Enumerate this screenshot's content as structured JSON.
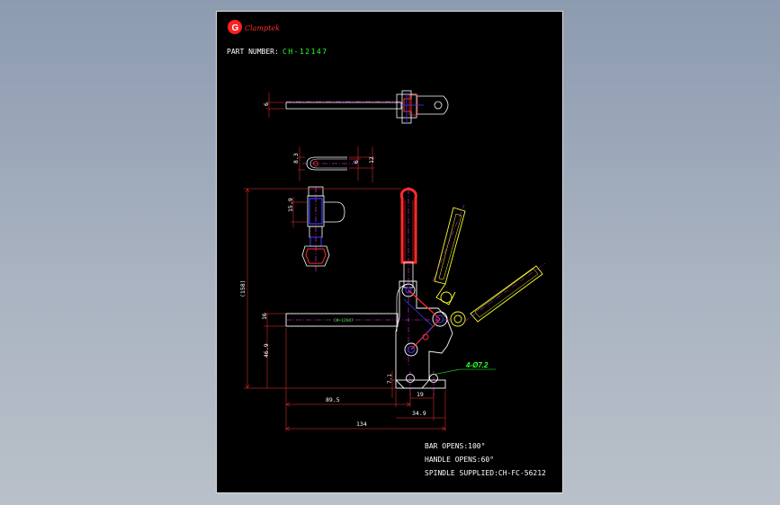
{
  "logo": {
    "letter": "G",
    "brand": "Clamptek"
  },
  "part_number": {
    "label": "PART NUMBER:",
    "value": "CH-12147"
  },
  "dimensions": {
    "top_view_thickness": "6",
    "bolt_left": "8.3",
    "bolt_inner": "6",
    "bolt_outer": "12",
    "spindle_len": "15.9",
    "overall_height": "(158)",
    "bar_width": "16",
    "bar_height": "46.9",
    "base_thk": "7.1",
    "hole_spacing": "19",
    "reach": "89.5",
    "base_len": "34.9",
    "overall_len": "134",
    "holes": "4-Ø7.2"
  },
  "bar_label": "CH-12147",
  "specs": [
    "BAR OPENS:100°",
    "HANDLE OPENS:60°",
    "SPINDLE SUPPLIED:CH-FC-56212"
  ],
  "colors": {
    "background": "#000000",
    "dimension": "#ff3030",
    "text": "#ffffff",
    "accent": "#30ff30",
    "outline": "#ffffff",
    "handle": "#ff2a2a",
    "bolt": "#3a3aff",
    "open_position": "#ffff30",
    "centerline": "#ff30ff"
  }
}
